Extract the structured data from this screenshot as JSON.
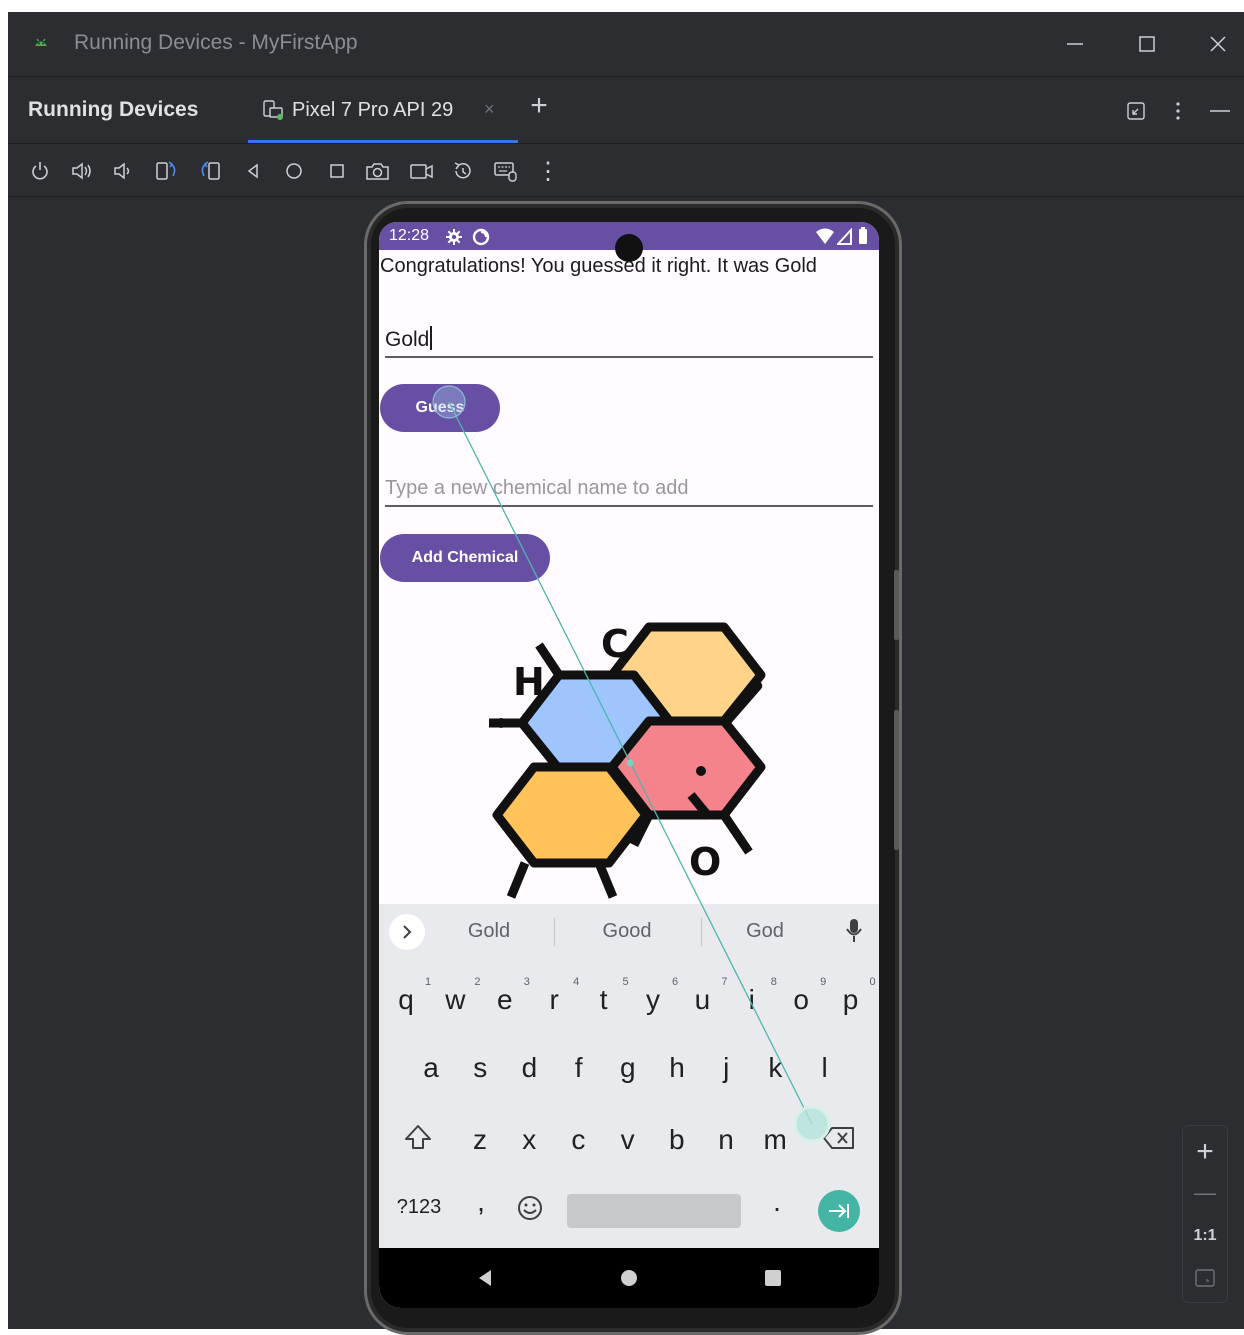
{
  "window": {
    "title": "Running Devices - MyFirstApp"
  },
  "tool_window": {
    "title": "Running Devices",
    "tab_label": "Pixel 7 Pro API 29",
    "tab_close": "×",
    "tab_add": "+"
  },
  "toolbar": {
    "more_label": "⋮",
    "buttons": [
      "power-icon",
      "volume-up-icon",
      "volume-down-icon",
      "rotate-left-icon",
      "rotate-right-icon",
      "back-icon",
      "home-icon",
      "overview-icon",
      "screenshot-icon",
      "screen-record-icon",
      "reset-icon",
      "keyboard-mouse-icon"
    ]
  },
  "device": {
    "status": {
      "time": "12:28"
    },
    "app": {
      "result_text": "Congratulations! You guessed it right. It was Gold",
      "guess_input_value": "Gold",
      "guess_button": "Guess",
      "add_input_placeholder": "Type a new chemical name to add",
      "add_button": "Add Chemical",
      "illustration_labels": {
        "c": "C",
        "h": "H",
        "o": "O"
      }
    },
    "keyboard": {
      "suggestions": [
        "Gold",
        "Good",
        "God"
      ],
      "row1": [
        "q",
        "w",
        "e",
        "r",
        "t",
        "y",
        "u",
        "i",
        "o",
        "p"
      ],
      "row1_nums": [
        "1",
        "2",
        "3",
        "4",
        "5",
        "6",
        "7",
        "8",
        "9",
        "0"
      ],
      "row2": [
        "a",
        "s",
        "d",
        "f",
        "g",
        "h",
        "j",
        "k",
        "l"
      ],
      "row3": [
        "z",
        "x",
        "c",
        "v",
        "b",
        "n",
        "m"
      ],
      "symbols_key": "?123",
      "comma_key": ",",
      "period_key": "."
    }
  },
  "zoom": {
    "ratio_label": "1:1",
    "zoom_in": "+",
    "zoom_out": "—"
  },
  "colors": {
    "ide_bg": "#2b2d30",
    "accent": "#3574f0",
    "app_primary": "#6750a4",
    "hex_blue": "#9ec5fe",
    "hex_orange": "#ffc35a",
    "hex_peach": "#ffd48a",
    "hex_pink": "#f4838b",
    "enter_key": "#44b4a4"
  }
}
